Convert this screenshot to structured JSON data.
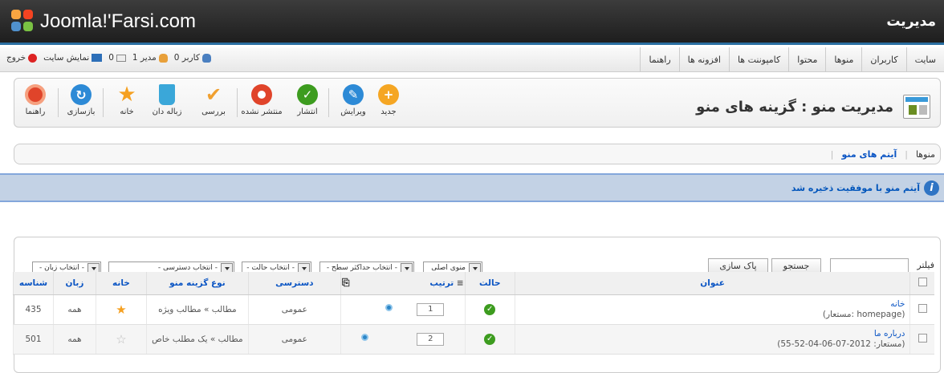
{
  "header": {
    "logo_text": "Joomla!'Farsi.com",
    "admin_title": "مدیریت"
  },
  "topmenu": {
    "items": [
      "سایت",
      "کاربران",
      "منوها",
      "محتوا",
      "کامپوننت ها",
      "افزونه ها",
      "راهنما"
    ]
  },
  "status": {
    "visitors": "0 کاربر",
    "admins": "1 مدیر",
    "messages": "0",
    "view_site": "نمایش سایت",
    "logout": "خروج"
  },
  "toolbar": {
    "page_title": "مدیریت منو : گزینه های منو",
    "buttons": [
      {
        "label": "جدید",
        "icon": "new-icon",
        "color": "#f5a623"
      },
      {
        "label": "ویرایش",
        "icon": "edit-icon",
        "color": "#2d8ad6"
      },
      {
        "label": "انتشار",
        "icon": "publish-icon",
        "color": "#3d9c1f"
      },
      {
        "label": "منتشر نشده",
        "icon": "unpublish-icon",
        "color": "#e0442a"
      },
      {
        "label": "بررسی",
        "icon": "checkin-icon",
        "color": "#f0a030"
      },
      {
        "label": "زباله دان",
        "icon": "trash-icon",
        "color": "#3aa7d9"
      },
      {
        "label": "خانه",
        "icon": "home-star-icon",
        "color": "#f5a020"
      },
      {
        "label": "بازسازی",
        "icon": "rebuild-icon",
        "color": "#2d8ad6"
      },
      {
        "label": "راهنما",
        "icon": "help-icon",
        "color": "#e0442a"
      }
    ]
  },
  "submenu": {
    "items": [
      "منوها",
      "آیتم های منو"
    ],
    "active": "آیتم های منو"
  },
  "message": {
    "text": "آیتم منو با موفقیت ذخیره شد"
  },
  "filters": {
    "label": "فیلتر",
    "search_button": "جستجو",
    "clear_button": "پاک سازی",
    "selects": [
      "منوی اصلی",
      "- انتخاب حداکثر سطح -",
      "- انتخاب حالت -",
      "- انتخاب دسترسی -",
      "- انتخاب زبان -"
    ]
  },
  "table": {
    "headers": {
      "title": "عنوان",
      "status": "حالت",
      "ordering": "ترتیب",
      "access": "دسترسی",
      "type": "نوع گزینه منو",
      "home": "خانه",
      "language": "زبان",
      "id": "شناسه"
    },
    "rows": [
      {
        "title": "خانه",
        "alias": "(مستعار: homepage)",
        "order": "1",
        "access": "عمومی",
        "type": "مطالب » مطالب ویژه",
        "home": true,
        "language": "همه",
        "id": "435"
      },
      {
        "title": "درباره ما",
        "alias": "(مستعار: 2012-07-06-04-52-55)",
        "order": "2",
        "access": "عمومی",
        "type": "مطالب » یک مطلب خاص",
        "home": false,
        "language": "همه",
        "id": "501"
      }
    ]
  },
  "colors": {
    "accent": "#0b55c4",
    "header_bg": "#2b2b2b",
    "message_bg": "#c3d2e5"
  }
}
